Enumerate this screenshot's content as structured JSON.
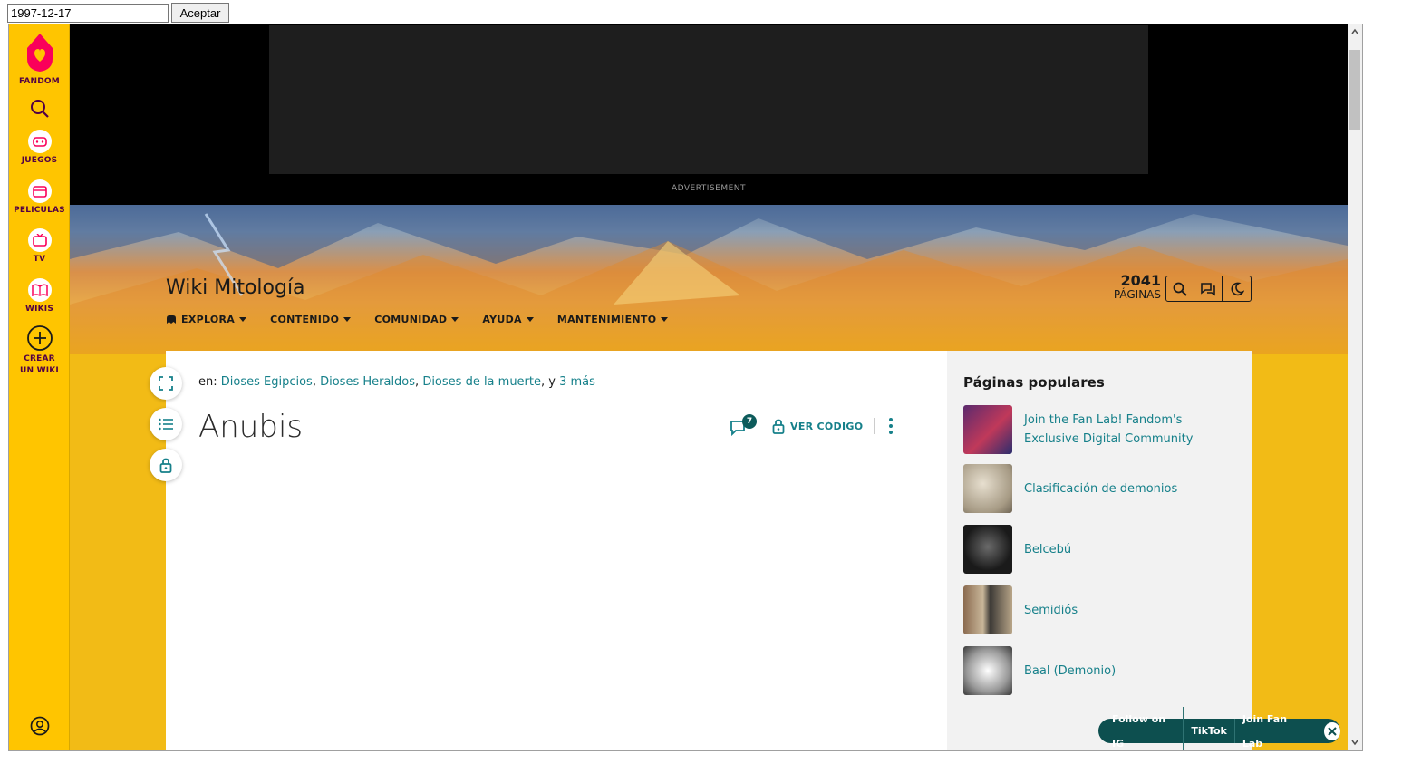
{
  "toolbar": {
    "date_value": "1997-12-17",
    "accept_label": "Aceptar"
  },
  "side_rail": {
    "logo_label": "FANDOM",
    "items": [
      {
        "label": "JUEGOS",
        "icon": "gamepad-icon"
      },
      {
        "label": "PELÍCULAS",
        "icon": "film-icon"
      },
      {
        "label": "TV",
        "icon": "tv-icon"
      },
      {
        "label": "WIKIS",
        "icon": "book-icon"
      },
      {
        "label": "CREAR UN WIKI",
        "icon": "plus-circle-icon"
      }
    ]
  },
  "ad": {
    "label": "ADVERTISEMENT"
  },
  "wiki": {
    "title": "Wiki Mitología",
    "page_count": "2041",
    "page_count_label": "PÁGINAS",
    "nav": [
      "EXPLORA",
      "CONTENIDO",
      "COMUNIDAD",
      "AYUDA",
      "MANTENIMIENTO"
    ]
  },
  "article": {
    "categories_prefix": "en:",
    "categories": [
      "Dioses Egipcios",
      "Dioses Heraldos",
      "Dioses de la muerte"
    ],
    "categories_more": "3 más",
    "categories_joiner": ", y",
    "title": "Anubis",
    "comment_count": "7",
    "view_source_label": "VER CÓDIGO"
  },
  "popular": {
    "heading": "Páginas populares",
    "items": [
      {
        "label": "Join the Fan Lab! Fandom's Exclusive Digital Community"
      },
      {
        "label": "Clasificación de demonios"
      },
      {
        "label": "Belcebú"
      },
      {
        "label": "Semidiós"
      },
      {
        "label": "Baal (Demonio)"
      }
    ]
  },
  "social_pill": {
    "links": [
      "Follow on IG",
      "TikTok",
      "Join Fan Lab"
    ]
  },
  "colors": {
    "rail": "#ffc500",
    "link": "#16808a",
    "pill": "#0d4f4f",
    "fandom_pink": "#fa005a"
  }
}
